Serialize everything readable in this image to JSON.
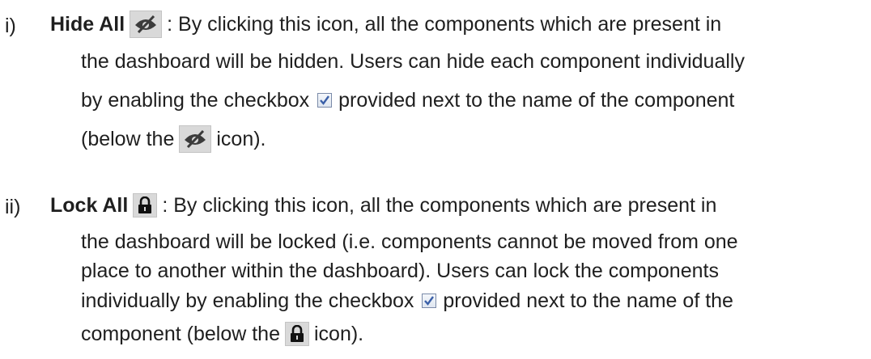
{
  "items": [
    {
      "marker": "i)",
      "term": "Hide All",
      "icon": "hide-eye-slash-icon",
      "lines": [
        ": By clicking this icon, all the components which are present in",
        "the dashboard will be hidden. Users can hide each component individually",
        "by enabling the checkbox",
        "provided next to the name of the component",
        "(below the",
        "icon)."
      ]
    },
    {
      "marker": "ii)",
      "term": "Lock All",
      "icon": "padlock-icon",
      "lines": [
        ": By clicking this icon, all the components which are present in",
        "the dashboard will be locked (i.e. components cannot be moved from one",
        "place to another within the dashboard). Users can lock the components",
        "individually by enabling the checkbox",
        "provided next to the name of the",
        "component (below the",
        "icon)."
      ]
    }
  ],
  "colors": {
    "text": "#1f1f1f",
    "icon_background": "#d9d9d9",
    "checkbox_check": "#3a5fa8"
  }
}
